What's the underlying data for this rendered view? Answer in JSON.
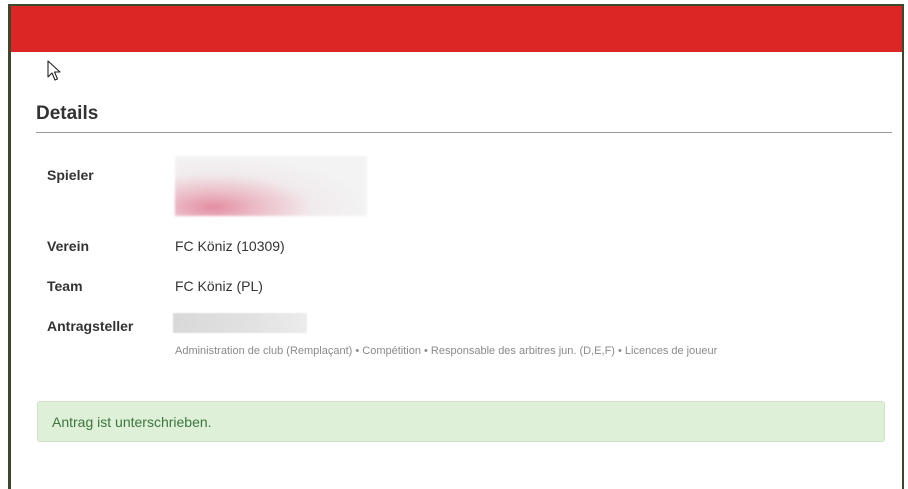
{
  "header": {
    "brand_color": "#dc2626"
  },
  "details": {
    "title": "Details",
    "player_label": "Spieler",
    "club_label": "Verein",
    "club_value": "FC Köniz (10309)",
    "team_label": "Team",
    "team_value": "FC Köniz (PL)",
    "applicant_label": "Antragsteller",
    "applicant_roles": "Administration de club (Remplaçant) • Compétition • Responsable des arbitres jun. (D,E,F) • Licences de joueur"
  },
  "alert": {
    "message": "Antrag ist unterschrieben.",
    "color": "#dff0d8"
  },
  "icons": {
    "cursor": "mouse-pointer-icon"
  }
}
